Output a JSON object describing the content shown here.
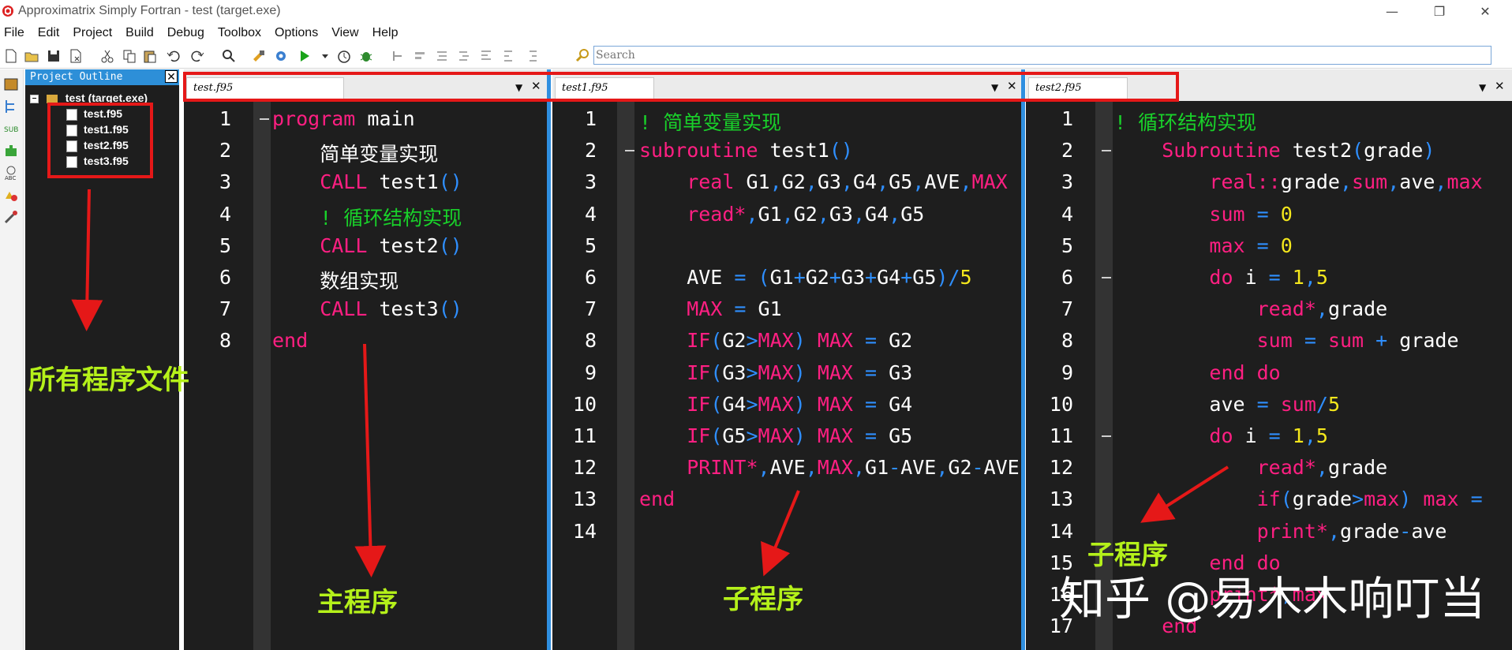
{
  "window": {
    "title": "Approximatrix Simply Fortran - test (target.exe)",
    "controls": [
      "—",
      "❐",
      "✕"
    ]
  },
  "menu": [
    "File",
    "Edit",
    "Project",
    "Build",
    "Debug",
    "Toolbox",
    "Options",
    "View",
    "Help"
  ],
  "toolbar": {
    "search_placeholder": "Search",
    "icons": [
      "new-file-icon",
      "open-folder-icon",
      "save-icon",
      "close-file-icon",
      "cut-icon",
      "copy-icon",
      "paste-icon",
      "undo-icon",
      "redo-icon",
      "find-icon",
      "build-icon",
      "settings-gear-icon",
      "run-icon",
      "run-dropdown-icon",
      "timer-icon",
      "debug-bug-icon",
      "indent-icon",
      "outdent-icon",
      "comment-icon",
      "uncomment-icon",
      "format-icon",
      "align-icon"
    ]
  },
  "left_strip": {
    "icons": [
      "project-icon",
      "outline-tree-icon",
      "subroutine-icon",
      "plugin-icon",
      "spelling-icon",
      "shapes-icon",
      "tools-icon"
    ]
  },
  "outline": {
    "title": "Project Outline",
    "close": "✕",
    "root": "test (target.exe)",
    "files": [
      "test.f95",
      "test1.f95",
      "test2.f95",
      "test3.f95"
    ]
  },
  "editors": [
    {
      "tab": "test.f95",
      "dropdown": "▼",
      "close": "✕",
      "lines": [
        [
          {
            "c": "kw",
            "t": "program"
          },
          {
            "c": "tx",
            "t": " main"
          }
        ],
        [
          {
            "c": "tx",
            "t": "    简单变量实现"
          }
        ],
        [
          {
            "c": "kw",
            "t": "    CALL"
          },
          {
            "c": "tx",
            "t": " test1"
          },
          {
            "c": "pn",
            "t": "()"
          }
        ],
        [
          {
            "c": "cm",
            "t": "    ! 循环结构实现"
          }
        ],
        [
          {
            "c": "kw",
            "t": "    CALL"
          },
          {
            "c": "tx",
            "t": " test2"
          },
          {
            "c": "pn",
            "t": "()"
          }
        ],
        [
          {
            "c": "tx",
            "t": "    数组实现"
          }
        ],
        [
          {
            "c": "kw",
            "t": "    CALL"
          },
          {
            "c": "tx",
            "t": " test3"
          },
          {
            "c": "pn",
            "t": "()"
          }
        ],
        [
          {
            "c": "kw",
            "t": "end"
          }
        ]
      ]
    },
    {
      "tab": "test1.f95",
      "dropdown": "▼",
      "close": "✕",
      "lines": [
        [
          {
            "c": "cm",
            "t": "! 简单变量实现"
          }
        ],
        [
          {
            "c": "kw",
            "t": "subroutine"
          },
          {
            "c": "tx",
            "t": " test1"
          },
          {
            "c": "pn",
            "t": "()"
          }
        ],
        [
          {
            "c": "kw",
            "t": "    real"
          },
          {
            "c": "tx",
            "t": " G1"
          },
          {
            "c": "pn",
            "t": ","
          },
          {
            "c": "tx",
            "t": "G2"
          },
          {
            "c": "pn",
            "t": ","
          },
          {
            "c": "tx",
            "t": "G3"
          },
          {
            "c": "pn",
            "t": ","
          },
          {
            "c": "tx",
            "t": "G4"
          },
          {
            "c": "pn",
            "t": ","
          },
          {
            "c": "tx",
            "t": "G5"
          },
          {
            "c": "pn",
            "t": ","
          },
          {
            "c": "tx",
            "t": "AVE"
          },
          {
            "c": "pn",
            "t": ","
          },
          {
            "c": "kw",
            "t": "MAX"
          }
        ],
        [
          {
            "c": "kw",
            "t": "    read*"
          },
          {
            "c": "pn",
            "t": ","
          },
          {
            "c": "tx",
            "t": "G1"
          },
          {
            "c": "pn",
            "t": ","
          },
          {
            "c": "tx",
            "t": "G2"
          },
          {
            "c": "pn",
            "t": ","
          },
          {
            "c": "tx",
            "t": "G3"
          },
          {
            "c": "pn",
            "t": ","
          },
          {
            "c": "tx",
            "t": "G4"
          },
          {
            "c": "pn",
            "t": ","
          },
          {
            "c": "tx",
            "t": "G5"
          }
        ],
        [
          {
            "c": "tx",
            "t": ""
          }
        ],
        [
          {
            "c": "tx",
            "t": "    AVE "
          },
          {
            "c": "pn",
            "t": "= ("
          },
          {
            "c": "tx",
            "t": "G1"
          },
          {
            "c": "pn",
            "t": "+"
          },
          {
            "c": "tx",
            "t": "G2"
          },
          {
            "c": "pn",
            "t": "+"
          },
          {
            "c": "tx",
            "t": "G3"
          },
          {
            "c": "pn",
            "t": "+"
          },
          {
            "c": "tx",
            "t": "G4"
          },
          {
            "c": "pn",
            "t": "+"
          },
          {
            "c": "tx",
            "t": "G5"
          },
          {
            "c": "pn",
            "t": ")/"
          },
          {
            "c": "nm",
            "t": "5"
          }
        ],
        [
          {
            "c": "kw",
            "t": "    MAX"
          },
          {
            "c": "pn",
            "t": " = "
          },
          {
            "c": "tx",
            "t": "G1"
          }
        ],
        [
          {
            "c": "kw",
            "t": "    IF"
          },
          {
            "c": "pn",
            "t": "("
          },
          {
            "c": "tx",
            "t": "G2"
          },
          {
            "c": "pn",
            "t": ">"
          },
          {
            "c": "kw",
            "t": "MAX"
          },
          {
            "c": "pn",
            "t": ") "
          },
          {
            "c": "kw",
            "t": "MAX"
          },
          {
            "c": "pn",
            "t": " = "
          },
          {
            "c": "tx",
            "t": "G2"
          }
        ],
        [
          {
            "c": "kw",
            "t": "    IF"
          },
          {
            "c": "pn",
            "t": "("
          },
          {
            "c": "tx",
            "t": "G3"
          },
          {
            "c": "pn",
            "t": ">"
          },
          {
            "c": "kw",
            "t": "MAX"
          },
          {
            "c": "pn",
            "t": ") "
          },
          {
            "c": "kw",
            "t": "MAX"
          },
          {
            "c": "pn",
            "t": " = "
          },
          {
            "c": "tx",
            "t": "G3"
          }
        ],
        [
          {
            "c": "kw",
            "t": "    IF"
          },
          {
            "c": "pn",
            "t": "("
          },
          {
            "c": "tx",
            "t": "G4"
          },
          {
            "c": "pn",
            "t": ">"
          },
          {
            "c": "kw",
            "t": "MAX"
          },
          {
            "c": "pn",
            "t": ") "
          },
          {
            "c": "kw",
            "t": "MAX"
          },
          {
            "c": "pn",
            "t": " = "
          },
          {
            "c": "tx",
            "t": "G4"
          }
        ],
        [
          {
            "c": "kw",
            "t": "    IF"
          },
          {
            "c": "pn",
            "t": "("
          },
          {
            "c": "tx",
            "t": "G5"
          },
          {
            "c": "pn",
            "t": ">"
          },
          {
            "c": "kw",
            "t": "MAX"
          },
          {
            "c": "pn",
            "t": ") "
          },
          {
            "c": "kw",
            "t": "MAX"
          },
          {
            "c": "pn",
            "t": " = "
          },
          {
            "c": "tx",
            "t": "G5"
          }
        ],
        [
          {
            "c": "kw",
            "t": "    PRINT*"
          },
          {
            "c": "pn",
            "t": ","
          },
          {
            "c": "tx",
            "t": "AVE"
          },
          {
            "c": "pn",
            "t": ","
          },
          {
            "c": "kw",
            "t": "MAX"
          },
          {
            "c": "pn",
            "t": ","
          },
          {
            "c": "tx",
            "t": "G1"
          },
          {
            "c": "pn",
            "t": "-"
          },
          {
            "c": "tx",
            "t": "AVE"
          },
          {
            "c": "pn",
            "t": ","
          },
          {
            "c": "tx",
            "t": "G2"
          },
          {
            "c": "pn",
            "t": "-"
          },
          {
            "c": "tx",
            "t": "AVE"
          }
        ],
        [
          {
            "c": "kw",
            "t": "end"
          }
        ],
        [
          {
            "c": "tx",
            "t": ""
          }
        ]
      ]
    },
    {
      "tab": "test2.f95",
      "dropdown": "▼",
      "close": "✕",
      "lines": [
        [
          {
            "c": "cm",
            "t": "! 循环结构实现"
          }
        ],
        [
          {
            "c": "kw",
            "t": "    Subroutine"
          },
          {
            "c": "tx",
            "t": " test2"
          },
          {
            "c": "pn",
            "t": "("
          },
          {
            "c": "tx",
            "t": "grade"
          },
          {
            "c": "pn",
            "t": ")"
          }
        ],
        [
          {
            "c": "kw",
            "t": "        real::"
          },
          {
            "c": "tx",
            "t": "grade"
          },
          {
            "c": "pn",
            "t": ","
          },
          {
            "c": "kw",
            "t": "sum"
          },
          {
            "c": "pn",
            "t": ","
          },
          {
            "c": "tx",
            "t": "ave"
          },
          {
            "c": "pn",
            "t": ","
          },
          {
            "c": "kw",
            "t": "max"
          }
        ],
        [
          {
            "c": "kw",
            "t": "        sum"
          },
          {
            "c": "pn",
            "t": " = "
          },
          {
            "c": "nm",
            "t": "0"
          }
        ],
        [
          {
            "c": "kw",
            "t": "        max"
          },
          {
            "c": "pn",
            "t": " = "
          },
          {
            "c": "nm",
            "t": "0"
          }
        ],
        [
          {
            "c": "kw",
            "t": "        do"
          },
          {
            "c": "tx",
            "t": " i "
          },
          {
            "c": "pn",
            "t": "= "
          },
          {
            "c": "nm",
            "t": "1"
          },
          {
            "c": "pn",
            "t": ","
          },
          {
            "c": "nm",
            "t": "5"
          }
        ],
        [
          {
            "c": "kw",
            "t": "            read*"
          },
          {
            "c": "pn",
            "t": ","
          },
          {
            "c": "tx",
            "t": "grade"
          }
        ],
        [
          {
            "c": "kw",
            "t": "            sum"
          },
          {
            "c": "pn",
            "t": " = "
          },
          {
            "c": "kw",
            "t": "sum"
          },
          {
            "c": "pn",
            "t": " + "
          },
          {
            "c": "tx",
            "t": "grade"
          }
        ],
        [
          {
            "c": "kw",
            "t": "        end do"
          }
        ],
        [
          {
            "c": "tx",
            "t": "        ave "
          },
          {
            "c": "pn",
            "t": "= "
          },
          {
            "c": "kw",
            "t": "sum"
          },
          {
            "c": "pn",
            "t": "/"
          },
          {
            "c": "nm",
            "t": "5"
          }
        ],
        [
          {
            "c": "kw",
            "t": "        do"
          },
          {
            "c": "tx",
            "t": " i "
          },
          {
            "c": "pn",
            "t": "= "
          },
          {
            "c": "nm",
            "t": "1"
          },
          {
            "c": "pn",
            "t": ","
          },
          {
            "c": "nm",
            "t": "5"
          }
        ],
        [
          {
            "c": "kw",
            "t": "            read*"
          },
          {
            "c": "pn",
            "t": ","
          },
          {
            "c": "tx",
            "t": "grade"
          }
        ],
        [
          {
            "c": "kw",
            "t": "            if"
          },
          {
            "c": "pn",
            "t": "("
          },
          {
            "c": "tx",
            "t": "grade"
          },
          {
            "c": "pn",
            "t": ">"
          },
          {
            "c": "kw",
            "t": "max"
          },
          {
            "c": "pn",
            "t": ") "
          },
          {
            "c": "kw",
            "t": "max"
          },
          {
            "c": "pn",
            "t": " ="
          }
        ],
        [
          {
            "c": "kw",
            "t": "            print*"
          },
          {
            "c": "pn",
            "t": ","
          },
          {
            "c": "tx",
            "t": "grade"
          },
          {
            "c": "pn",
            "t": "-"
          },
          {
            "c": "tx",
            "t": "ave"
          }
        ],
        [
          {
            "c": "kw",
            "t": "        end do"
          }
        ],
        [
          {
            "c": "kw",
            "t": "        print*"
          },
          {
            "c": "pn",
            "t": ","
          },
          {
            "c": "kw",
            "t": "max"
          }
        ],
        [
          {
            "c": "kw",
            "t": "    end"
          }
        ]
      ]
    }
  ],
  "annotations": {
    "all_files": "所有程序文件",
    "main_program": "主程序",
    "subprogram_1": "子程序",
    "subprogram_2": "子程序",
    "watermark": "知乎 @易木木响叮当"
  },
  "colors": {
    "accent_blue": "#2f8fe0",
    "annotation_red": "#e51818",
    "annotation_green": "#b5f11a",
    "keyword": "#ff1f82",
    "punct": "#2f8fff",
    "number": "#f4e71c",
    "comment": "#19d12a"
  }
}
